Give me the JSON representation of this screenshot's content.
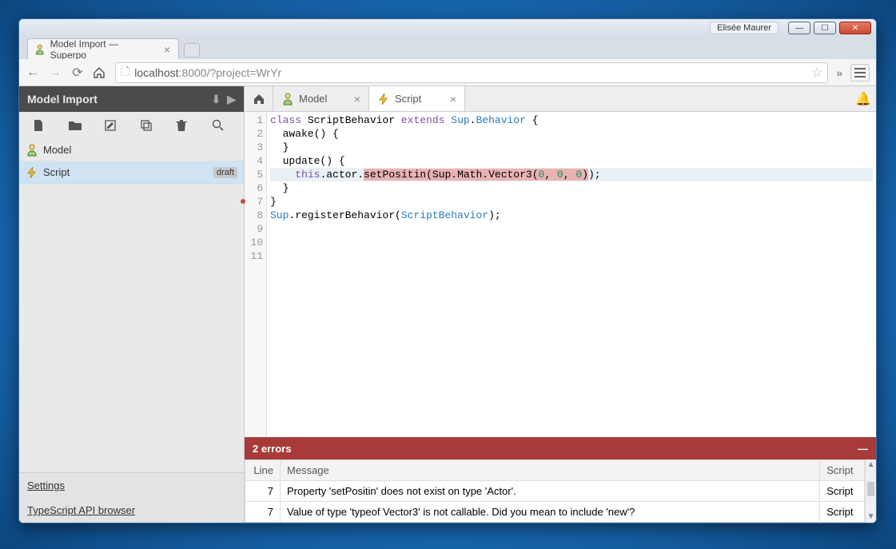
{
  "window": {
    "user_label": "Elisée Maurer"
  },
  "browser": {
    "tab_title": "Model Import — Superpo",
    "url_host": "localhost",
    "url_port": ":8000",
    "url_path": "/?project=WrYr"
  },
  "sidebar": {
    "title": "Model Import",
    "assets": [
      {
        "name": "Model",
        "type": "model"
      },
      {
        "name": "Script",
        "type": "script",
        "draft": "draft",
        "selected": true
      }
    ],
    "footer_links": [
      "Settings",
      "TypeScript API browser"
    ]
  },
  "editor": {
    "tabs": [
      {
        "label": "Model",
        "type": "model"
      },
      {
        "label": "Script",
        "type": "script",
        "active": true
      }
    ],
    "line_count": 11,
    "error_line": 7,
    "code_tokens": [
      [
        {
          "t": "class ",
          "c": "k-key"
        },
        {
          "t": "ScriptBehavior ",
          "c": ""
        },
        {
          "t": "extends ",
          "c": "k-key"
        },
        {
          "t": "Sup",
          "c": "k-type"
        },
        {
          "t": ".",
          "c": ""
        },
        {
          "t": "Behavior",
          "c": "k-type"
        },
        {
          "t": " {",
          "c": ""
        }
      ],
      [
        {
          "t": "  awake() {",
          "c": ""
        }
      ],
      [
        {
          "t": "",
          "c": ""
        }
      ],
      [
        {
          "t": "  }",
          "c": ""
        }
      ],
      [
        {
          "t": "",
          "c": ""
        }
      ],
      [
        {
          "t": "  update() {",
          "c": ""
        }
      ],
      [
        {
          "t": "    ",
          "c": ""
        },
        {
          "t": "this",
          "c": "k-this"
        },
        {
          "t": ".actor.",
          "c": ""
        },
        {
          "t": "setPositin",
          "c": "err-span"
        },
        {
          "t": "(",
          "c": "err-span"
        },
        {
          "t": "Sup.Math.Vector3(",
          "c": "err-span"
        },
        {
          "t": "0",
          "c": "err-span k-num"
        },
        {
          "t": ", ",
          "c": "err-span"
        },
        {
          "t": "0",
          "c": "err-span k-num"
        },
        {
          "t": ", ",
          "c": "err-span"
        },
        {
          "t": "0",
          "c": "err-span k-num"
        },
        {
          "t": ")",
          "c": "err-span"
        },
        {
          "t": ");",
          "c": ""
        }
      ],
      [
        {
          "t": "  }",
          "c": ""
        }
      ],
      [
        {
          "t": "}",
          "c": ""
        }
      ],
      [
        {
          "t": "Sup",
          "c": "k-type"
        },
        {
          "t": ".registerBehavior(",
          "c": ""
        },
        {
          "t": "ScriptBehavior",
          "c": "k-type"
        },
        {
          "t": ");",
          "c": ""
        }
      ],
      [
        {
          "t": "",
          "c": ""
        }
      ]
    ]
  },
  "errors": {
    "header": "2 errors",
    "columns": {
      "line": "Line",
      "message": "Message",
      "script": "Script"
    },
    "rows": [
      {
        "line": "7",
        "message": "Property 'setPositin' does not exist on type 'Actor'.",
        "script": "Script"
      },
      {
        "line": "7",
        "message": "Value of type 'typeof Vector3' is not callable. Did you mean to include 'new'?",
        "script": "Script"
      }
    ]
  }
}
